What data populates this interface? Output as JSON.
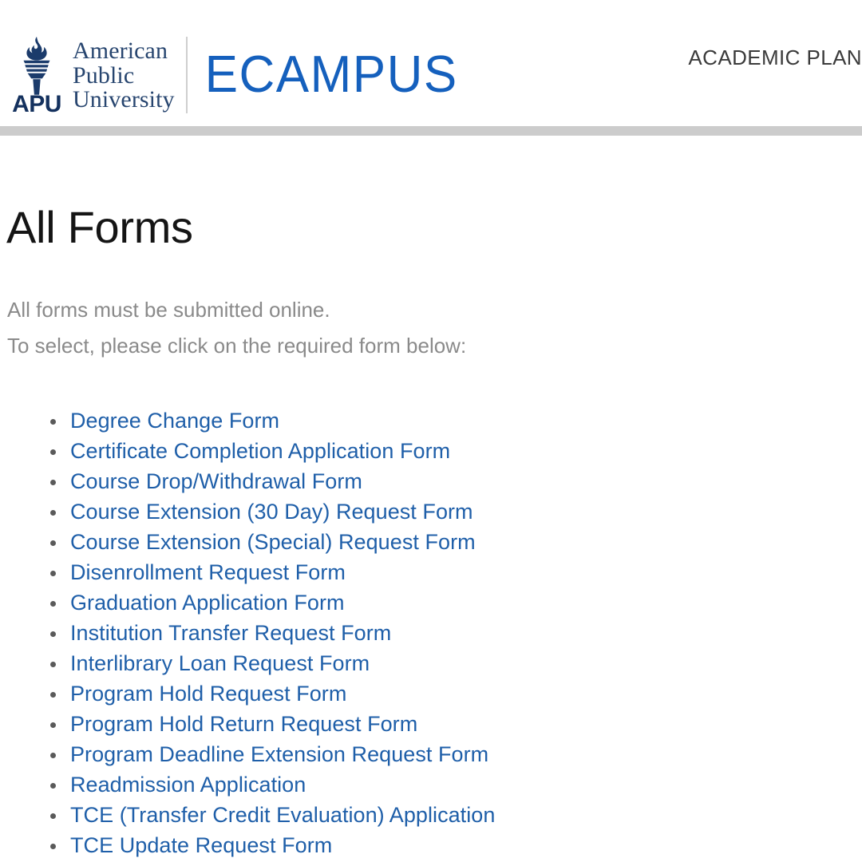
{
  "header": {
    "logo": {
      "icon": "torch-icon",
      "wordmark": "APU",
      "name_line1": "American",
      "name_line2": "Public",
      "name_line3": "University"
    },
    "product_name": "ECAMPUS",
    "section_label": "ACADEMIC PLAN",
    "rule_color": "#cccccc"
  },
  "main": {
    "title": "All Forms",
    "intro_line1": "All forms must be submitted online.",
    "intro_line2": "To select, please click on the required form below:",
    "forms": [
      {
        "label": "Degree Change Form"
      },
      {
        "label": "Certificate Completion Application Form"
      },
      {
        "label": "Course Drop/Withdrawal Form"
      },
      {
        "label": "Course Extension (30 Day) Request Form"
      },
      {
        "label": "Course Extension (Special) Request Form"
      },
      {
        "label": "Disenrollment Request Form"
      },
      {
        "label": "Graduation Application Form"
      },
      {
        "label": "Institution Transfer Request Form"
      },
      {
        "label": "Interlibrary Loan Request Form"
      },
      {
        "label": "Program Hold Request Form"
      },
      {
        "label": "Program Hold Return Request Form"
      },
      {
        "label": "Program Deadline Extension Request Form"
      },
      {
        "label": "Readmission Application"
      },
      {
        "label": "TCE (Transfer Credit Evaluation) Application"
      },
      {
        "label": "TCE Update Request Form"
      }
    ]
  },
  "colors": {
    "link_blue": "#1f5fa9",
    "brand_navy": "#14315e",
    "ecampus_blue": "#1560bd",
    "body_gray": "#8a8a8a",
    "rule_gray": "#cccccc"
  }
}
